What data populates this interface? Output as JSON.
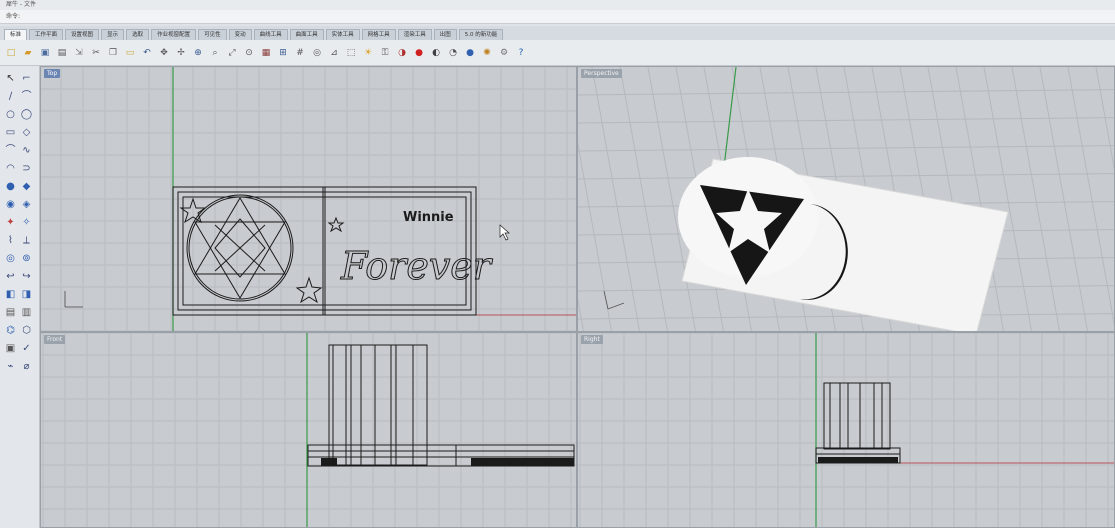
{
  "window": {
    "title": "犀牛 - 文件",
    "command_prompt": "命令:"
  },
  "tabs": [
    {
      "label": "标准",
      "active": true
    },
    {
      "label": "工作平面"
    },
    {
      "label": "设置视图"
    },
    {
      "label": "显示"
    },
    {
      "label": "选取"
    },
    {
      "label": "作业视窗配置"
    },
    {
      "label": "可见性"
    },
    {
      "label": "变动"
    },
    {
      "label": "曲线工具"
    },
    {
      "label": "曲面工具"
    },
    {
      "label": "实体工具"
    },
    {
      "label": "网格工具"
    },
    {
      "label": "渲染工具"
    },
    {
      "label": "出图"
    },
    {
      "label": "5.0 的新功能"
    }
  ],
  "toolbar": {
    "icons": [
      "new-icon",
      "open-icon",
      "save-icon",
      "print-icon",
      "import-icon",
      "cut-icon",
      "copy-icon",
      "paste-icon",
      "undo-icon",
      "pan-icon",
      "rotate-icon",
      "zoom-icon",
      "zoom-window-icon",
      "zoom-extents-icon",
      "zoom-selected-icon",
      "layout-icon",
      "four-view-icon",
      "grid-icon",
      "osnap-icon",
      "cplane-icon",
      "select-icon",
      "light-icon",
      "lock-icon",
      "material-icon",
      "render-icon",
      "shade-icon",
      "ghost-icon",
      "sphere-icon",
      "texture-icon",
      "settings-icon",
      "help-icon"
    ]
  },
  "viewports": {
    "top": {
      "label": "Top"
    },
    "persp": {
      "label": "Perspective"
    },
    "front": {
      "label": "Front"
    },
    "right": {
      "label": "Right"
    }
  },
  "model": {
    "name_text": "Winnie",
    "script_text": "Forever"
  },
  "colors": {
    "viewport_bg": "#c9ccd0",
    "grid_minor": "#b8bcc1",
    "grid_major": "#a9aeb4",
    "axis_x": "#b8505a",
    "axis_y": "#3a9a4a",
    "wire": "#1b1b1b"
  }
}
